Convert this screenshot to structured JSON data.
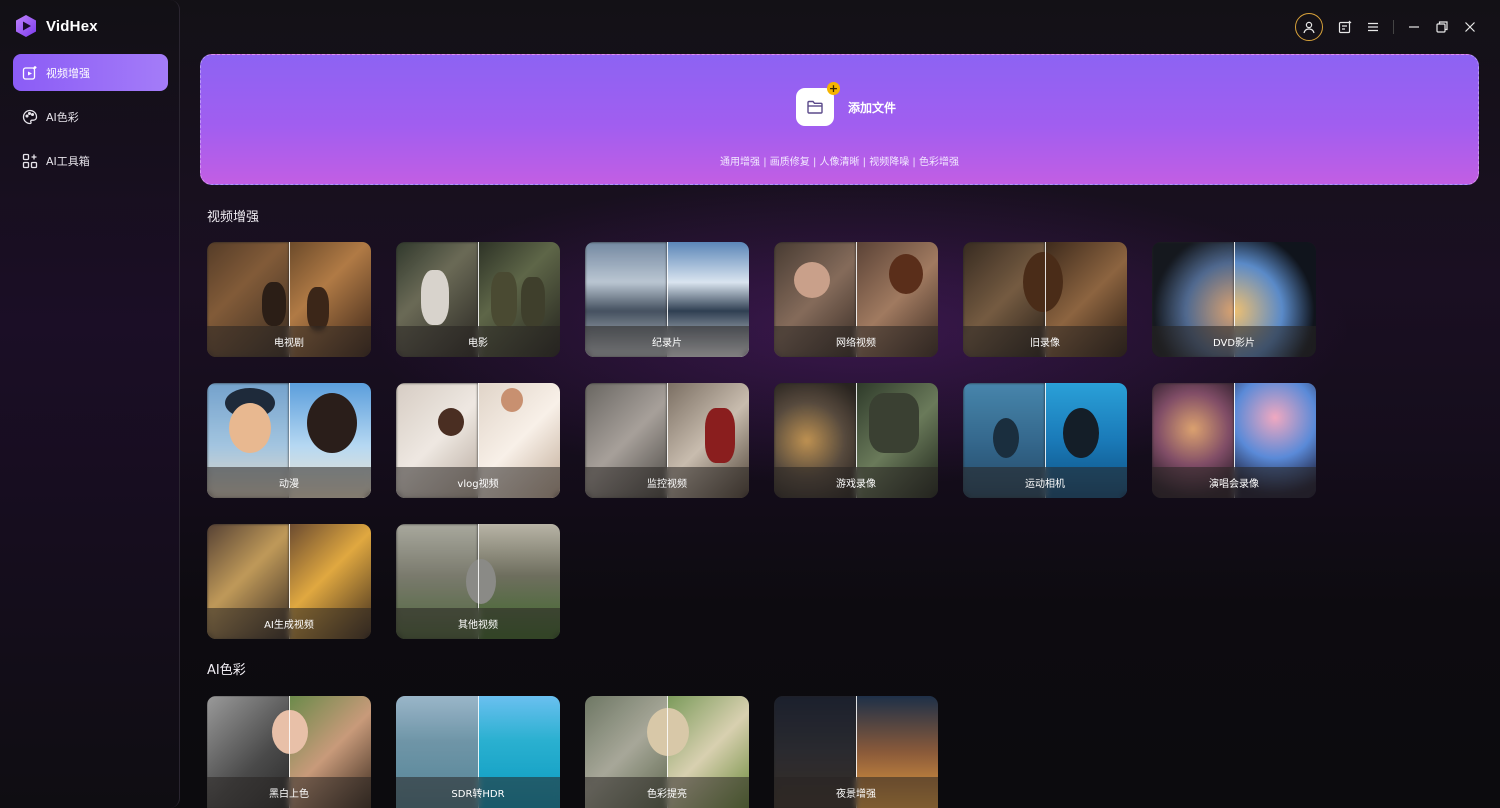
{
  "app": {
    "name": "VidHex"
  },
  "sidebar": {
    "items": [
      {
        "label": "视频增强",
        "icon": "video-enhance-icon",
        "active": true
      },
      {
        "label": "AI色彩",
        "icon": "palette-icon",
        "active": false
      },
      {
        "label": "AI工具箱",
        "icon": "toolbox-icon",
        "active": false
      }
    ]
  },
  "titlebar": {
    "icons": [
      "user-icon",
      "feedback-icon",
      "menu-icon",
      "minimize-icon",
      "restore-icon",
      "close-icon"
    ],
    "accent": "#d8a23a"
  },
  "upload": {
    "label": "添加文件",
    "subtitle": "通用增强 | 画质修复 | 人像清晰 | 视频降噪 | 色彩增强"
  },
  "sections": {
    "enhance": {
      "title": "视频增强",
      "cards": [
        "电视剧",
        "电影",
        "纪录片",
        "网络视频",
        "旧录像",
        "DVD影片",
        "动漫",
        "vlog视频",
        "监控视频",
        "游戏录像",
        "运动相机",
        "演唱会录像",
        "AI生成视频",
        "其他视频"
      ]
    },
    "color": {
      "title": "AI色彩",
      "cards": [
        "黑白上色",
        "SDR转HDR",
        "色彩提亮",
        "夜景增强"
      ]
    }
  },
  "colors": {
    "active_nav": "#8b5cf6",
    "banner_top": "#8d63f3",
    "banner_bottom": "#c25ee3"
  }
}
